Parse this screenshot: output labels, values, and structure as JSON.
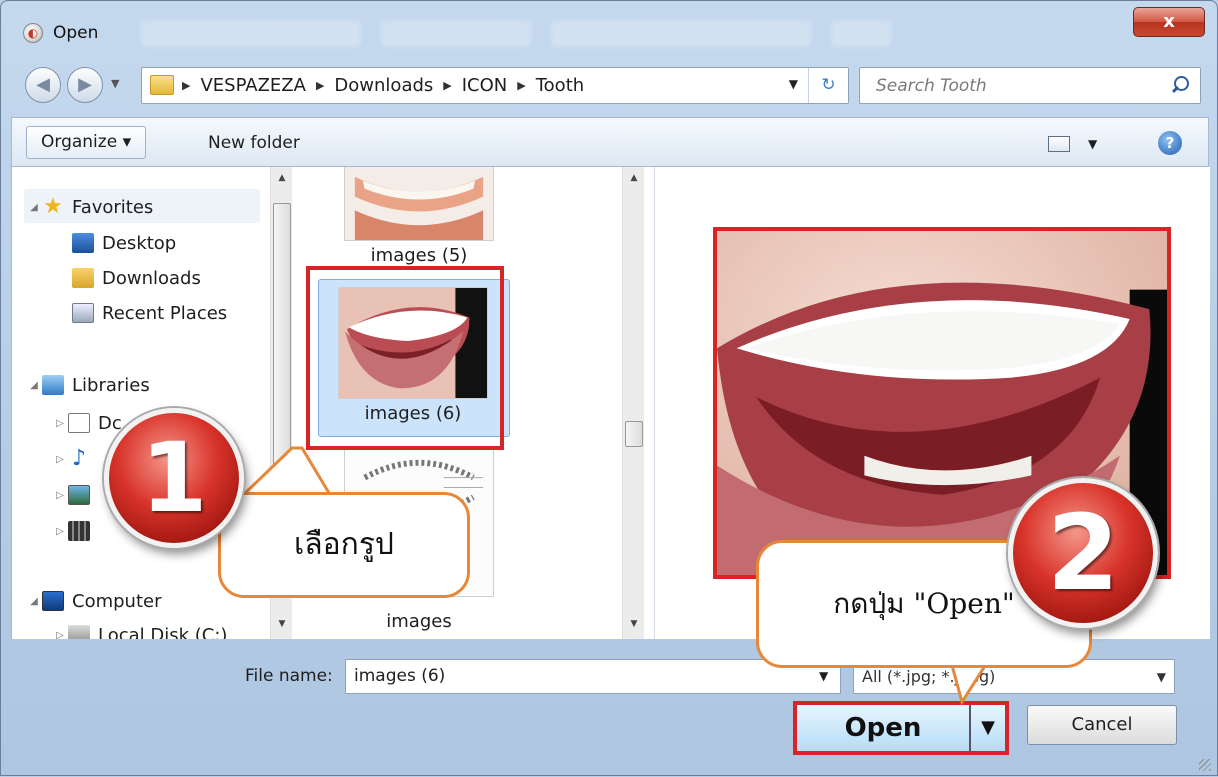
{
  "window": {
    "title": "Open",
    "close_label": "x"
  },
  "address": {
    "crumbs": [
      "VESPAZEZA",
      "Downloads",
      "ICON",
      "Tooth"
    ],
    "search_placeholder": "Search Tooth"
  },
  "toolbar": {
    "organize_label": "Organize ▾",
    "new_folder_label": "New folder",
    "help_label": "?"
  },
  "nav": {
    "favorites_label": "Favorites",
    "items": [
      "Desktop",
      "Downloads",
      "Recent Places"
    ],
    "libraries_label": "Libraries",
    "lib_item_partial": "Dc",
    "computer_label": "Computer",
    "disk_label": "Local Disk (C:)"
  },
  "files": {
    "items": [
      "images (5)",
      "images (6)",
      "images"
    ]
  },
  "bottom": {
    "file_name_label": "File name:",
    "file_name_value": "images (6)",
    "filter_value": "All (*.jpg; *.jpeg)",
    "open_label": "Open",
    "cancel_label": "Cancel"
  },
  "annotations": {
    "step1_number": "1",
    "step1_text": "เลือกรูป",
    "step2_number": "2",
    "step2_text": "กดปุ่ม \"Open\""
  },
  "colors": {
    "highlight_red": "#d82328",
    "callout_orange": "#e88738",
    "selection_blue": "#cce4fb"
  }
}
